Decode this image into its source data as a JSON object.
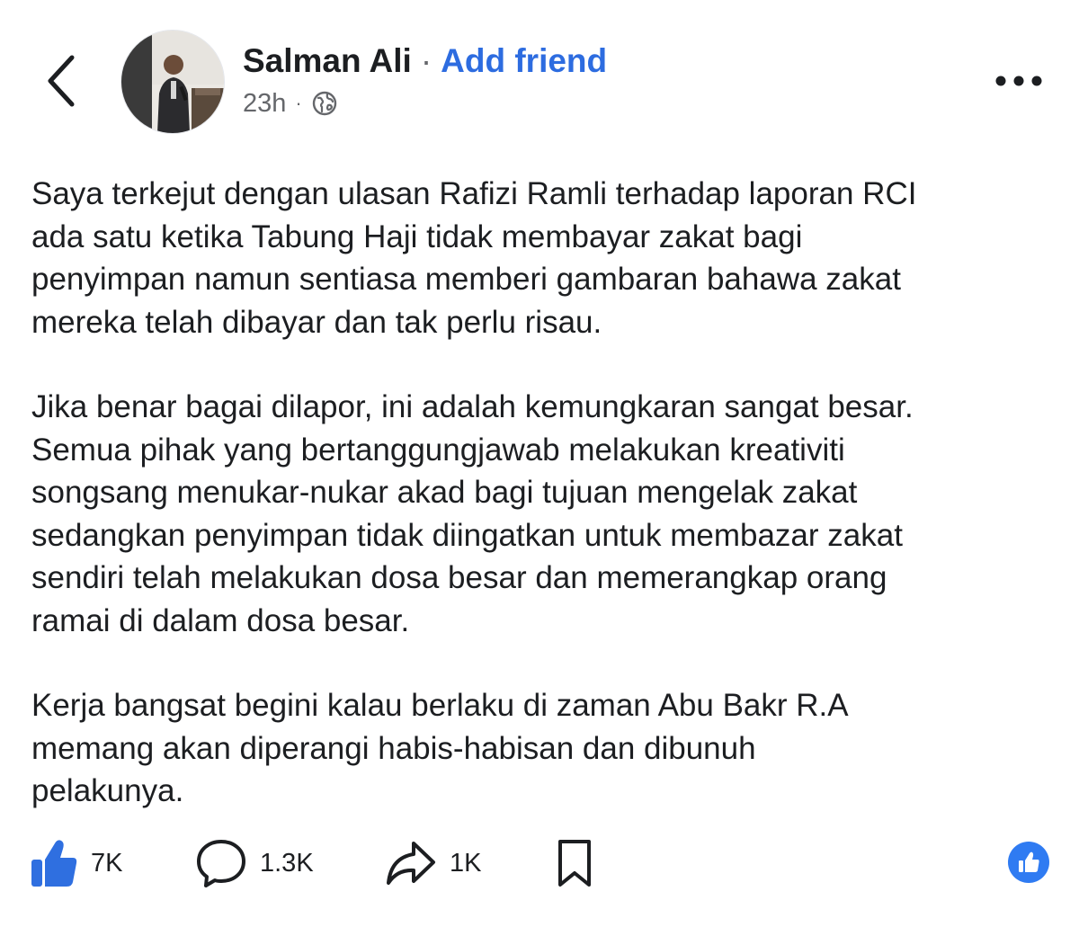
{
  "post": {
    "author": "Salman Ali",
    "separator": "·",
    "add_friend_label": "Add friend",
    "time": "23h",
    "meta_separator": "·",
    "privacy_icon": "globe-icon",
    "paragraphs": [
      "Saya terkejut dengan ulasan Rafizi Ramli terhadap laporan RCI\nada satu ketika Tabung Haji tidak membayar zakat bagi\npenyimpan namun sentiasa memberi gambaran bahawa zakat\nmereka telah dibayar dan tak perlu risau.",
      "Jika benar bagai dilapor, ini adalah kemungkaran sangat besar.\nSemua pihak yang bertanggungjawab melakukan kreativiti\nsongsang menukar-nukar akad bagi tujuan mengelak zakat\nsedangkan penyimpan tidak diingatkan untuk membazar zakat\nsendiri telah melakukan dosa besar dan memerangkap orang\nramai di dalam dosa besar.",
      "Kerja bangsat begini kalau berlaku di zaman Abu Bakr R.A\nmemang akan diperangi habis-habisan dan dibunuh\npelakunya."
    ]
  },
  "actions": {
    "like_count": "7K",
    "comment_count": "1.3K",
    "share_count": "1K"
  },
  "icons": {
    "back": "chevron-left-icon",
    "more": "more-horizontal-icon",
    "like": "thumbs-up-icon",
    "comment": "comment-bubble-icon",
    "share": "share-arrow-icon",
    "save": "bookmark-icon",
    "reaction": "like-reaction-icon"
  },
  "colors": {
    "link_blue": "#2d6ce0",
    "like_blue": "#2f7bf2",
    "text": "#1c1e21",
    "muted": "#65676b"
  }
}
